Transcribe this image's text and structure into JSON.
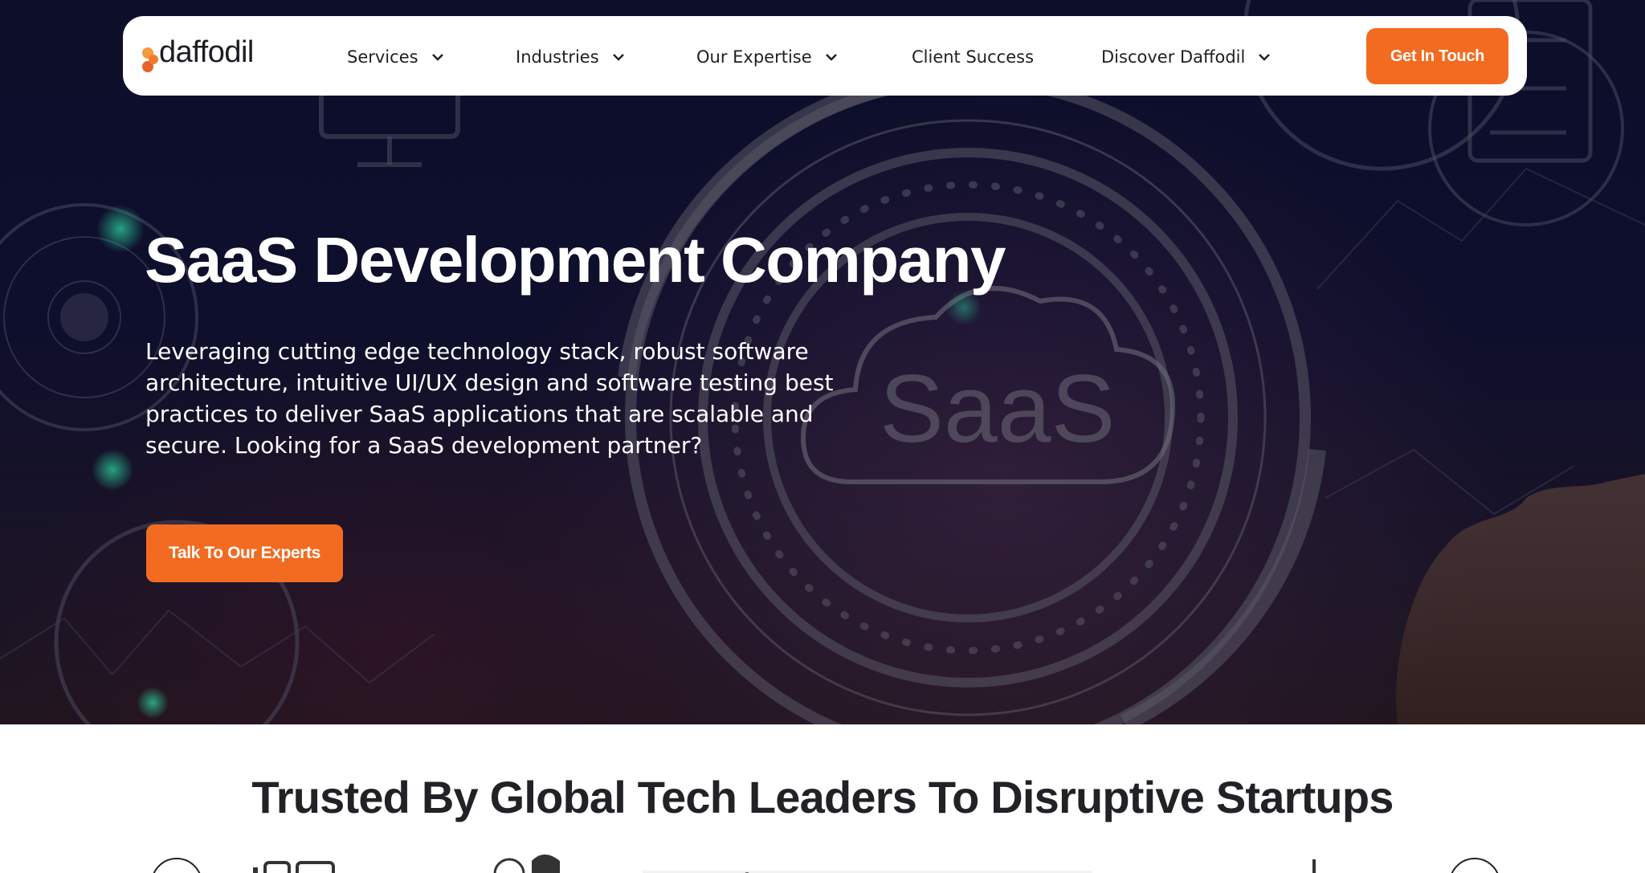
{
  "brand": {
    "name": "daffodil",
    "accent": "#f26b21"
  },
  "nav": {
    "items": [
      {
        "label": "Services",
        "has_dropdown": true
      },
      {
        "label": "Industries",
        "has_dropdown": true
      },
      {
        "label": "Our Expertise",
        "has_dropdown": true
      },
      {
        "label": "Client Success",
        "has_dropdown": false
      },
      {
        "label": "Discover Daffodil",
        "has_dropdown": true
      }
    ],
    "cta_label": "Get In Touch"
  },
  "hero": {
    "title": "SaaS Development Company",
    "description": "Leveraging cutting edge technology stack, robust software architecture, intuitive UI/UX design and software testing best practices to deliver SaaS applications that are scalable and secure.    Looking for a SaaS development partner?",
    "cta_label": "Talk To Our Experts",
    "image_text": "SaaS"
  },
  "trusted": {
    "title": "Trusted By Global Tech Leaders To Disruptive Startups"
  }
}
